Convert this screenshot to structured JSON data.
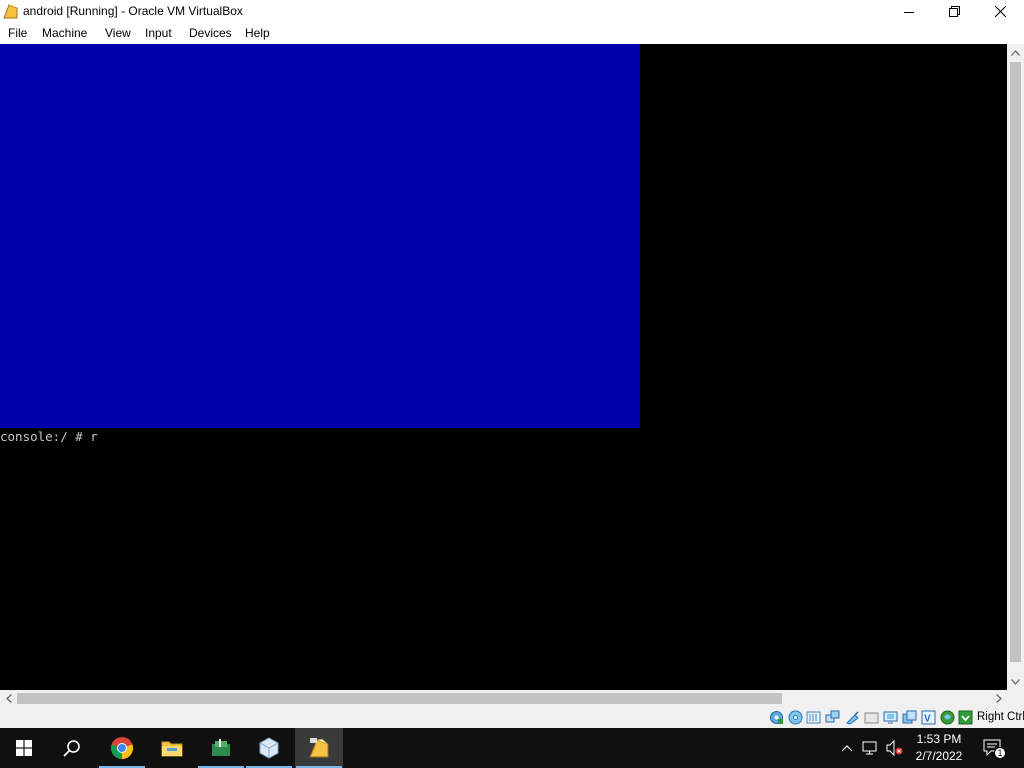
{
  "window": {
    "title": "android [Running] - Oracle VM VirtualBox"
  },
  "menu": {
    "items": [
      "File",
      "Machine",
      "View",
      "Input",
      "Devices",
      "Help"
    ]
  },
  "vm": {
    "console_text": "console:/ # r",
    "screen_color": "#0000aa"
  },
  "statusbar": {
    "icons": [
      "hard-disk-icon",
      "optical-drive-icon",
      "audio-icon",
      "network-icon",
      "usb-icon",
      "shared-folders-icon",
      "display-icon",
      "video-capture-icon",
      "virtualization-icon",
      "mouse-integration-icon",
      "keyboard-icon"
    ],
    "host_key": "Right Ctrl"
  },
  "taskbar": {
    "apps": [
      "start-icon",
      "search-icon",
      "chrome-icon",
      "file-explorer-icon",
      "app-icon",
      "virtualbox-icon",
      "virtualbox-vm-icon"
    ],
    "time": "1:53 PM",
    "date": "2/7/2022",
    "notification_count": "1"
  }
}
